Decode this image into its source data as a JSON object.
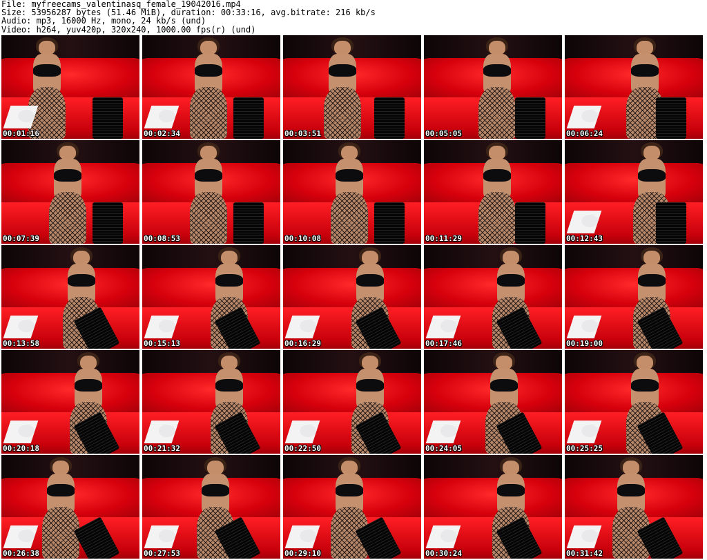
{
  "header": {
    "file": "File: myfreecams_valentinasq_female_19042016.mp4",
    "size": "Size: 53956287 bytes (51.46 MiB), duration: 00:33:16, avg.bitrate: 216 kb/s",
    "audio": "Audio: mp3, 16000 Hz, mono, 24 kb/s (und)",
    "video": "Video: h264, yuv420p, 320x240, 1000.00 fps(r) (und)"
  },
  "thumbnails": [
    {
      "timestamp": "00:01:16"
    },
    {
      "timestamp": "00:02:34"
    },
    {
      "timestamp": "00:03:51"
    },
    {
      "timestamp": "00:05:05"
    },
    {
      "timestamp": "00:06:24"
    },
    {
      "timestamp": "00:07:39"
    },
    {
      "timestamp": "00:08:53"
    },
    {
      "timestamp": "00:10:08"
    },
    {
      "timestamp": "00:11:29"
    },
    {
      "timestamp": "00:12:43"
    },
    {
      "timestamp": "00:13:58"
    },
    {
      "timestamp": "00:15:13"
    },
    {
      "timestamp": "00:16:29"
    },
    {
      "timestamp": "00:17:46"
    },
    {
      "timestamp": "00:19:00"
    },
    {
      "timestamp": "00:20:18"
    },
    {
      "timestamp": "00:21:32"
    },
    {
      "timestamp": "00:22:50"
    },
    {
      "timestamp": "00:24:05"
    },
    {
      "timestamp": "00:25:25"
    },
    {
      "timestamp": "00:26:38"
    },
    {
      "timestamp": "00:27:53"
    },
    {
      "timestamp": "00:29:10"
    },
    {
      "timestamp": "00:30:24"
    },
    {
      "timestamp": "00:31:42"
    }
  ],
  "colors": {
    "sofa": "#e0000f",
    "wall": "#1a0708",
    "timestamp_text": "#ffffff",
    "timestamp_outline": "#000000"
  }
}
